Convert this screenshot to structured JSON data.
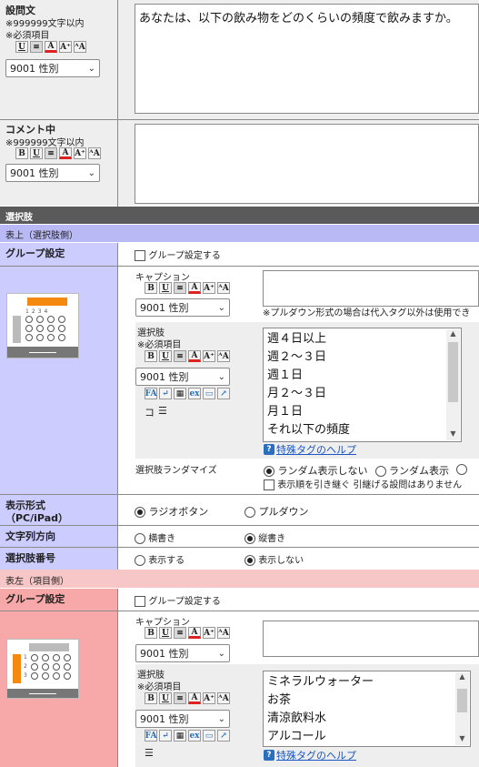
{
  "question_text": {
    "label": "設問文",
    "limit": "※999999文字以内",
    "required": "※必須項目",
    "font_select": "9001 性別",
    "value": "あなたは、以下の飲み物をどのくらいの頻度で飲みますか。"
  },
  "comment": {
    "label": "コメント中",
    "limit": "※999999文字以内",
    "font_select": "9001 性別"
  },
  "choices_section": {
    "title": "選択肢"
  },
  "top_side": {
    "title": "表上（選択肢側）",
    "group_label": "グループ設定",
    "group_checkbox": "グループ設定する",
    "caption_label": "キャプション",
    "caption_select": "9001 性別",
    "caption_note": "※プルダウン形式の場合は代入タグ以外は使用でき",
    "choices_label": "選択肢",
    "choices_required": "※必須項目",
    "choices_select": "9001 性別",
    "choices": [
      "週４日以上",
      "週２～３日",
      "週１日",
      "月２～３日",
      "月１日",
      "それ以下の頻度"
    ],
    "help_link": "特殊タグのヘルプ",
    "random_label": "選択肢ランダマイズ",
    "random_options": [
      "ランダム表示しない",
      "ランダム表示"
    ],
    "random_selected": 0,
    "inherit_checkbox": "表示順を引き継ぐ 引継げる設問はありません",
    "toolbar_extra": "コ"
  },
  "display_format": {
    "label_line1": "表示形式",
    "label_line2": "（PC/iPad）",
    "options": [
      "ラジオボタン",
      "プルダウン"
    ],
    "selected": 0
  },
  "text_direction": {
    "label": "文字列方向",
    "options": [
      "横書き",
      "縦書き"
    ],
    "selected": 1
  },
  "choice_number": {
    "label": "選択肢番号",
    "options": [
      "表示する",
      "表示しない"
    ],
    "selected": 1
  },
  "left_side": {
    "title": "表左（項目側）",
    "group_label": "グループ設定",
    "group_checkbox": "グループ設定する",
    "caption_label": "キャプション",
    "caption_select": "9001 性別",
    "choices_label": "選択肢",
    "choices_required": "※必須項目",
    "choices_select": "9001 性別",
    "choices": [
      "ミネラルウォーター",
      "お茶",
      "清涼飲料水",
      "アルコール"
    ],
    "help_link": "特殊タグのヘルプ"
  },
  "toolbar": {
    "bold": "B",
    "underline": "U",
    "color": "A",
    "size": "A",
    "small": "A"
  },
  "colors": {
    "section_header_bg": "#5a5a5a",
    "top_band_bg": "#b9b9f5",
    "left_band_bg": "#f7c7c7",
    "top_cell_bg": "#ccccff",
    "left_cell_bg": "#f7a8a8",
    "label_bg": "#eeeeee",
    "orange": "#f5890f"
  }
}
